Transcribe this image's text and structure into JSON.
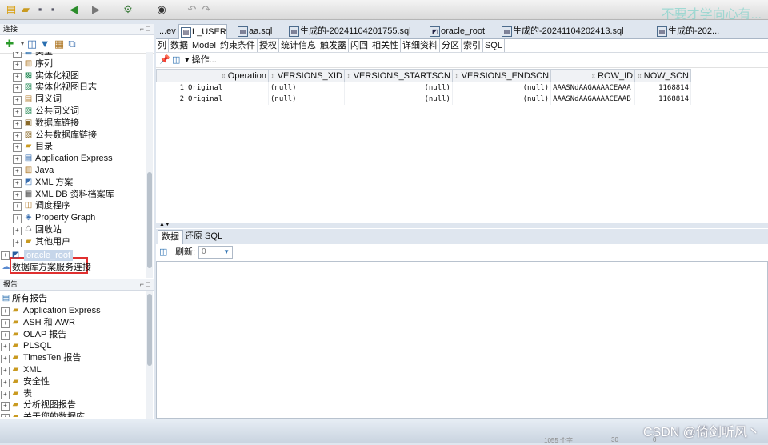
{
  "left_panel": {
    "connections_title": "连接",
    "tree_items": [
      {
        "label": "类型",
        "icon": "type-icon"
      },
      {
        "label": "序列",
        "icon": "sequence-icon"
      },
      {
        "label": "实体化视图",
        "icon": "matview-icon"
      },
      {
        "label": "实体化视图日志",
        "icon": "matview-log-icon"
      },
      {
        "label": "同义词",
        "icon": "synonym-icon"
      },
      {
        "label": "公共同义词",
        "icon": "public-synonym-icon"
      },
      {
        "label": "数据库链接",
        "icon": "dblink-icon"
      },
      {
        "label": "公共数据库链接",
        "icon": "public-dblink-icon"
      },
      {
        "label": "目录",
        "icon": "directory-icon"
      },
      {
        "label": "Application Express",
        "icon": "apex-icon"
      },
      {
        "label": "Java",
        "icon": "java-icon"
      },
      {
        "label": "XML 方案",
        "icon": "xml-schema-icon"
      },
      {
        "label": "XML DB 资料档案库",
        "icon": "xmldb-icon"
      },
      {
        "label": "调度程序",
        "icon": "scheduler-icon"
      },
      {
        "label": "Property Graph",
        "icon": "property-graph-icon"
      },
      {
        "label": "回收站",
        "icon": "recycle-bin-icon"
      },
      {
        "label": "其他用户",
        "icon": "other-users-icon"
      }
    ],
    "root_connection": "oracle_root",
    "schema_service_label": "数据库方案服务连接",
    "reports_title": "报告",
    "report_root": "所有报告",
    "report_items": [
      "Application Express",
      "ASH 和 AWR",
      "OLAP 报告",
      "PLSQL",
      "TimesTen 报告",
      "XML",
      "安全性",
      "表",
      "分析视图报告",
      "关于您的数据库"
    ]
  },
  "tabs": [
    {
      "label": "...ev",
      "icon": ""
    },
    {
      "label": "L_USER",
      "icon": "table-tab-icon",
      "active": true
    },
    {
      "label": "aa.sql",
      "icon": "sql-tab-icon"
    },
    {
      "label": "生成的-20241104201755.sql",
      "icon": "sql-tab-icon"
    },
    {
      "label": "oracle_root",
      "icon": "connection-tab-icon"
    },
    {
      "label": "生成的-20241104202413.sql",
      "icon": "sql-tab-icon"
    },
    {
      "label": "生成的-202...",
      "icon": "sql-tab-icon"
    }
  ],
  "subtabs": [
    "列",
    "数据",
    "Model",
    "约束条件",
    "授权",
    "统计信息",
    "触发器",
    "闪回",
    "相关性",
    "详细资料",
    "分区",
    "索引",
    "SQL"
  ],
  "actions_label": "▾ 操作...",
  "grid": {
    "columns": [
      "Operation",
      "VERSIONS_XID",
      "VERSIONS_STARTSCN",
      "VERSIONS_ENDSCN",
      "ROW_ID",
      "NOW_SCN"
    ],
    "rows": [
      {
        "num": "1",
        "cells": [
          "Original",
          "(null)",
          "(null)",
          "(null)",
          "AAASNdAAGAAAACEAAA",
          "1168814"
        ]
      },
      {
        "num": "2",
        "cells": [
          "Original",
          "(null)",
          "(null)",
          "(null)",
          "AAASNdAAGAAAACEAAB",
          "1168814"
        ]
      }
    ]
  },
  "lower": {
    "tabs": [
      "数据",
      "还原 SQL"
    ],
    "refresh_label": "刷新:",
    "refresh_value": "0"
  },
  "watermarks": {
    "top": "不要才学向心有...",
    "bottom": "CSDN @倚剑听风丶"
  },
  "status": [
    "1055 个字",
    "30",
    "0"
  ]
}
